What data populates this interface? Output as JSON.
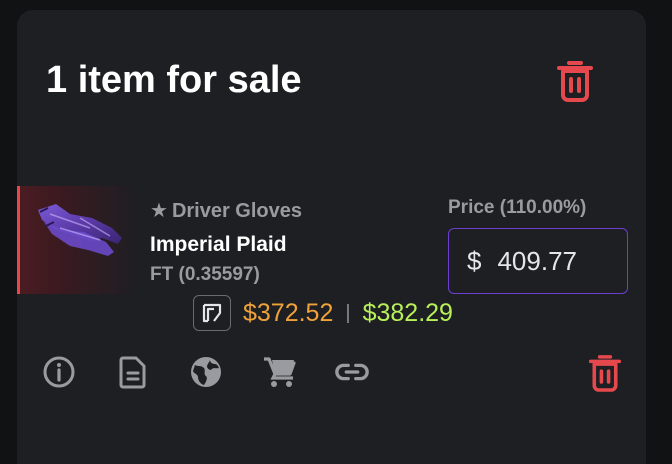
{
  "header": {
    "title": "1 item for sale"
  },
  "item": {
    "type": "Driver Gloves",
    "star": "★",
    "name": "Imperial Plaid",
    "wear": "FT (0.35597)"
  },
  "price": {
    "label": "Price (110.00%)",
    "currency": "$",
    "value": "409.77"
  },
  "market": {
    "price_a": "$372.52",
    "separator": "|",
    "price_b": "$382.29"
  },
  "actions": {
    "icons": [
      "info-icon",
      "document-icon",
      "globe-icon",
      "cart-icon",
      "link-icon",
      "trash-icon"
    ]
  },
  "colors": {
    "panel": "#1e1f23",
    "accent_red": "#e5484d",
    "accent_purple": "#6b3fd0",
    "price_orange": "#f0a23a",
    "price_green": "#b8f05a"
  }
}
